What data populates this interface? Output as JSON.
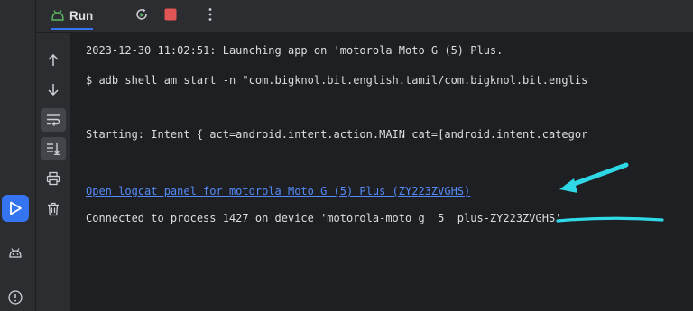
{
  "toolbar": {
    "run_tab_label": "Run",
    "icons": [
      "run-icon",
      "rerun-icon",
      "stop-icon",
      "more-options-icon"
    ]
  },
  "left_strip": {
    "icons": [
      "run-tool-window-icon",
      "android-icon",
      "problems-icon"
    ]
  },
  "gutter": {
    "icons": [
      "arrow-up-icon",
      "arrow-down-icon",
      "soft-wrap-icon",
      "scroll-to-end-icon",
      "print-icon",
      "trash-icon"
    ]
  },
  "console": {
    "lines": [
      "2023-12-30 11:02:51: Launching app on 'motorola Moto G (5) Plus.",
      "$ adb shell am start -n \"com.bigknol.bit.english.tamil/com.bigknol.bit.englis",
      "Starting: Intent { act=android.intent.action.MAIN cat=[android.intent.categor",
      "Open logcat panel for motorola Moto G (5) Plus (ZY223ZVGHS)",
      "Connected to process 1427 on device 'motorola-moto_g__5__plus-ZY223ZVGHS'."
    ]
  },
  "colors": {
    "accent": "#3574f0",
    "link": "#548af7",
    "annotation": "#2ed8e6",
    "stop": "#e05555",
    "run_green": "#5fb865"
  }
}
